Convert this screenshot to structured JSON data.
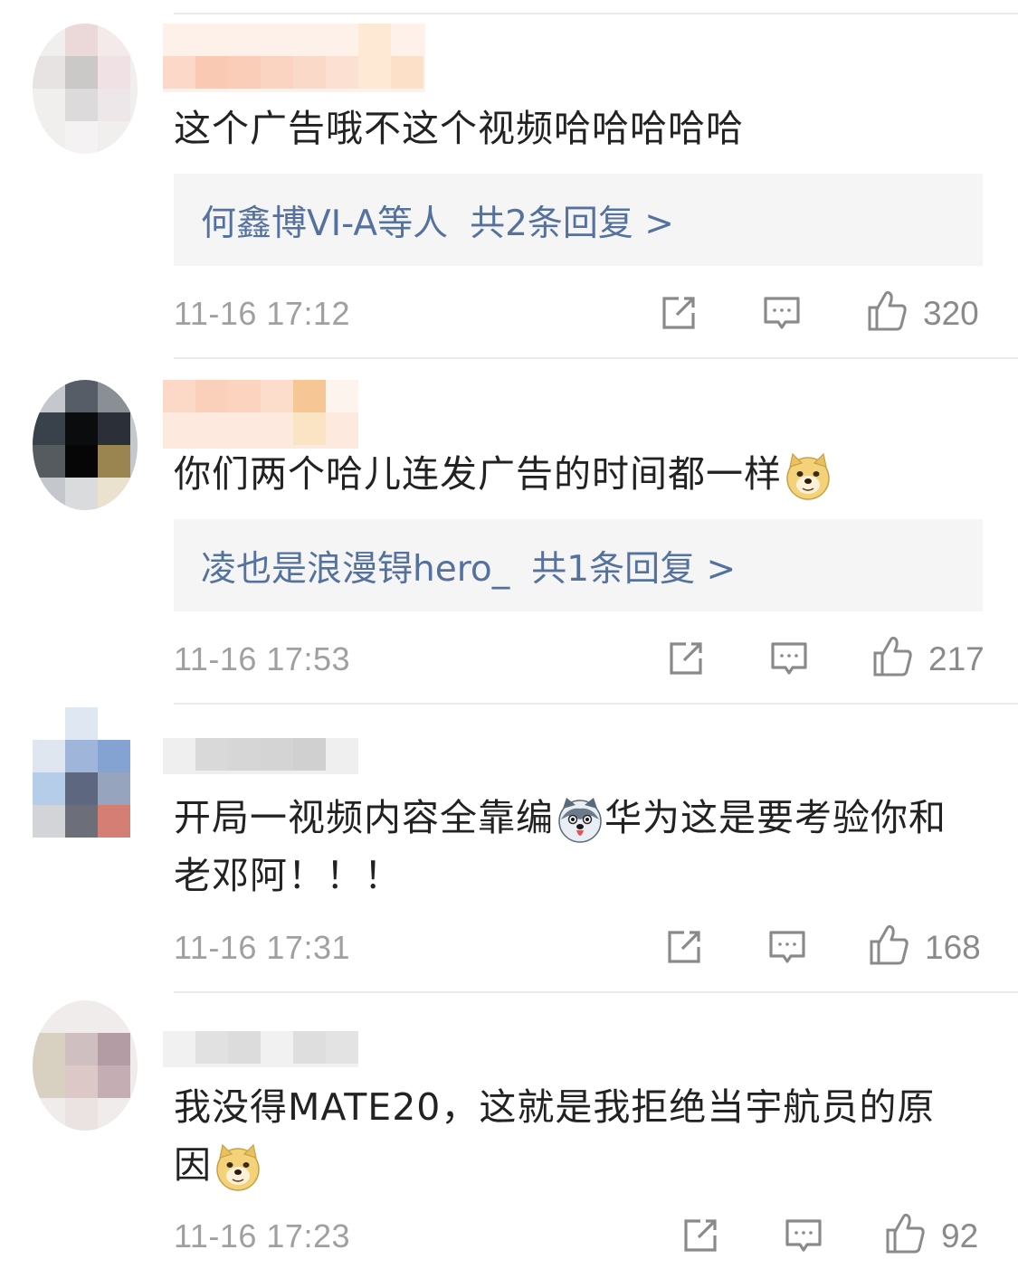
{
  "comments": [
    {
      "text": "这个广告哦不这个视频哈哈哈哈哈",
      "emoji": null,
      "reply_users": "何鑫博VI-A等人",
      "reply_count_label": "共2条回复 >",
      "time": "11-16 17:12",
      "likes": "320"
    },
    {
      "text": "你们两个哈儿连发广告的时间都一样",
      "emoji": "doge-face-icon",
      "reply_users": "凌也是浪漫锝hero_",
      "reply_count_label": "共1条回复 >",
      "time": "11-16 17:53",
      "likes": "217"
    },
    {
      "text_part1": "开局一视频内容全靠编",
      "emoji": "husky-face-icon",
      "text_part2": "华为这是要考验你和老邓阿！！！",
      "time": "11-16 17:31",
      "likes": "168"
    },
    {
      "text": "我没得MATE20，这就是我拒绝当宇航员的原因",
      "emoji": "doge-face-icon",
      "time": "11-16 17:23",
      "likes": "92"
    }
  ],
  "colors": {
    "reply_link": "#55729e",
    "reply_bg": "#f5f5f5",
    "meta_text": "#a0a0a0"
  }
}
